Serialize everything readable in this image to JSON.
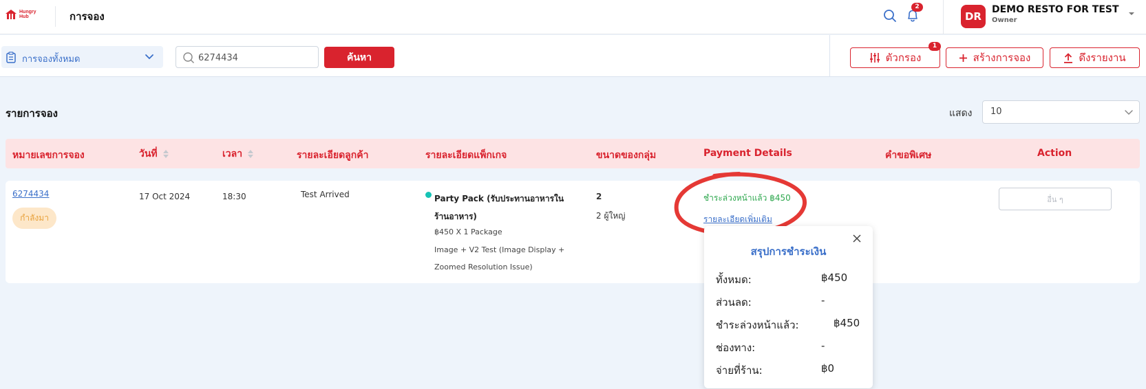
{
  "header": {
    "logo_text": "Hungry Hub",
    "page_title": "การจอง",
    "notification_count": "2",
    "avatar_initials": "DR",
    "restaurant_name": "DEMO RESTO FOR TEST",
    "role": "Owner"
  },
  "filters": {
    "scope_label": "การจองทั้งหมด",
    "search_value": "6274434",
    "search_button": "ค้นหา",
    "filter_button": "ตัวกรอง",
    "filter_count": "1",
    "create_button": "สร้างการจอง",
    "export_button": "ดึงรายงาน"
  },
  "list": {
    "title": "รายการจอง",
    "show_label": "แสดง",
    "page_size": "10"
  },
  "table": {
    "columns": [
      "หมายเลขการจอง",
      "วันที่",
      "เวลา",
      "รายละเอียดลูกค้า",
      "รายละเอียดแพ็กเกจ",
      "ขนาดของกลุ่ม",
      "Payment Details",
      "คำขอพิเศษ",
      "Action"
    ],
    "rows": [
      {
        "booking_id": "6274434",
        "status": "กำลังมา",
        "date": "17 Oct 2024",
        "time": "18:30",
        "customer": "Test Arrived",
        "package_name": "Party Pack (รับประทานอาหารในร้านอาหาร)",
        "package_price": "฿450 X 1 Package",
        "package_note_1": "Image + V2 Test (Image Display +",
        "package_note_2": "Zoomed Resolution Issue)",
        "party_size": "2",
        "party_detail": "2 ผู้ใหญ่",
        "payment_status": "ชำระล่วงหน้าแล้ว ฿450",
        "payment_more": "รายละเอียดเพิ่มเติม",
        "action": "อื่น ๆ"
      }
    ]
  },
  "payment_summary": {
    "title": "สรุปการชำระเงิน",
    "lines": [
      {
        "label": "ทั้งหมด:",
        "value": "฿450"
      },
      {
        "label": "ส่วนลด:",
        "value": "-"
      },
      {
        "label": "ชำระล่วงหน้าแล้ว:",
        "value": "฿450"
      },
      {
        "label": "ช่องทาง:",
        "value": "-"
      },
      {
        "label": "จ่ายที่ร้าน:",
        "value": "฿0"
      }
    ]
  },
  "colors": {
    "brand_red": "#d9232e",
    "link_blue": "#3a6fc9",
    "paid_green": "#2fa84f",
    "annotation_red": "#e53935"
  }
}
